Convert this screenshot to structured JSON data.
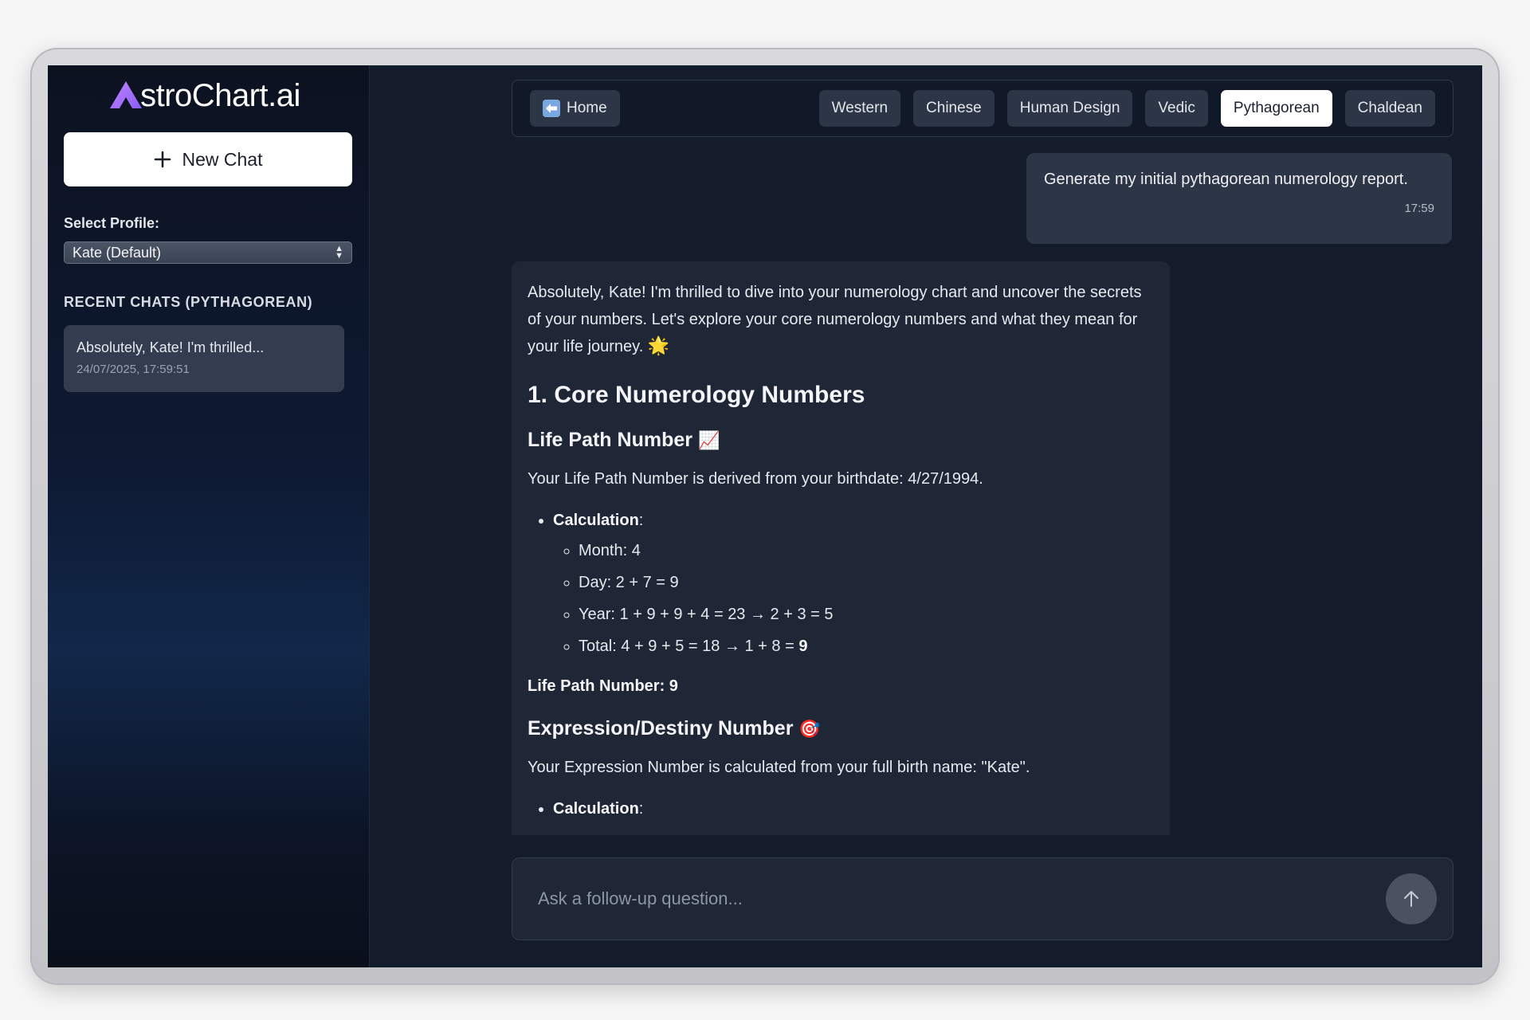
{
  "sidebar": {
    "logo_text": "stroChart.ai",
    "new_chat_label": "New Chat",
    "profile_label": "Select Profile:",
    "profile_selected": "Kate (Default)",
    "recent_title": "RECENT CHATS (PYTHAGOREAN)",
    "recent_chats": [
      {
        "title": "Absolutely, Kate! I'm thrilled...",
        "time": "24/07/2025, 17:59:51"
      }
    ]
  },
  "nav": {
    "home_label": "Home",
    "tabs": [
      "Western",
      "Chinese",
      "Human Design",
      "Vedic",
      "Pythagorean",
      "Chaldean"
    ],
    "active_tab": "Pythagorean"
  },
  "user_message": {
    "text": "Generate my initial pythagorean numerology report.",
    "time": "17:59"
  },
  "bot_message": {
    "intro": "Absolutely, Kate! I'm thrilled to dive into your numerology chart and uncover the secrets of your numbers. Let's explore your core numerology numbers and what they mean for your life journey.",
    "intro_emoji": "🌟",
    "section1_title": "1. Core Numerology Numbers",
    "life_path_title": "Life Path Number",
    "life_path_emoji": "📈",
    "life_path_desc": "Your Life Path Number is derived from your birthdate: 4/27/1994.",
    "calculation_label": "Calculation",
    "calc_steps": [
      "Month: 4",
      "Day: 2 + 7 = 9",
      "Year: 1 + 9 + 9 + 4 = 23 → 2 + 3 = 5",
      "Total: 4 + 9 + 5 = 18 → 1 + 8 = "
    ],
    "calc_total_bold": "9",
    "life_path_result": "Life Path Number: 9",
    "expression_title": "Expression/Destiny Number",
    "expression_emoji": "🎯",
    "expression_desc": "Your Expression Number is calculated from your full birth name: \"Kate\".",
    "calculation_label_2": "Calculation"
  },
  "input": {
    "placeholder": "Ask a follow-up question..."
  },
  "colors": {
    "accent_logo": "#a855f7",
    "background": "#141b2b",
    "bubble": "#2d3646"
  }
}
